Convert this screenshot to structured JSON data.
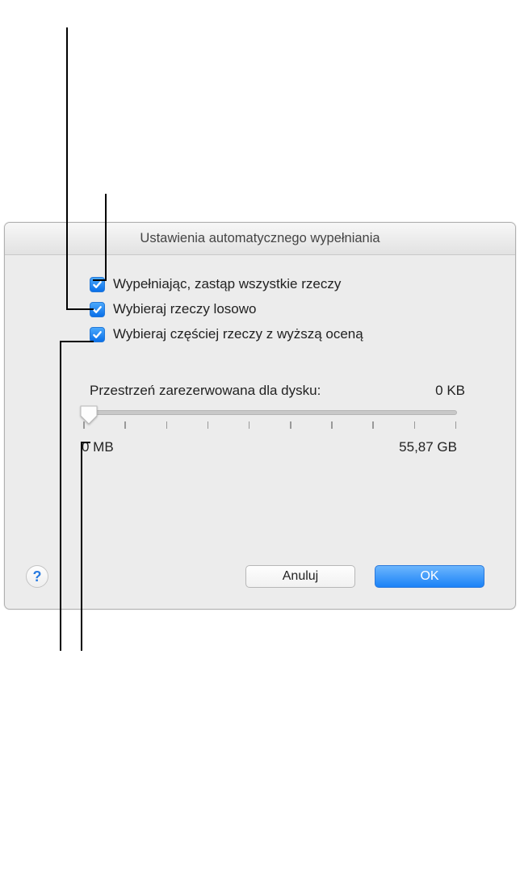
{
  "dialog": {
    "title": "Ustawienia automatycznego wypełniania",
    "checkboxes": [
      {
        "label": "Wypełniając, zastąp wszystkie rzeczy",
        "checked": true
      },
      {
        "label": "Wybieraj rzeczy losowo",
        "checked": true
      },
      {
        "label": "Wybieraj częściej rzeczy z wyższą oceną",
        "checked": true
      }
    ],
    "disk": {
      "label": "Przestrzeń zarezerwowana dla dysku:",
      "value": "0 KB",
      "slider_min_label": "0 MB",
      "slider_max_label": "55,87 GB"
    },
    "buttons": {
      "cancel": "Anuluj",
      "ok": "OK",
      "help": "?"
    }
  }
}
